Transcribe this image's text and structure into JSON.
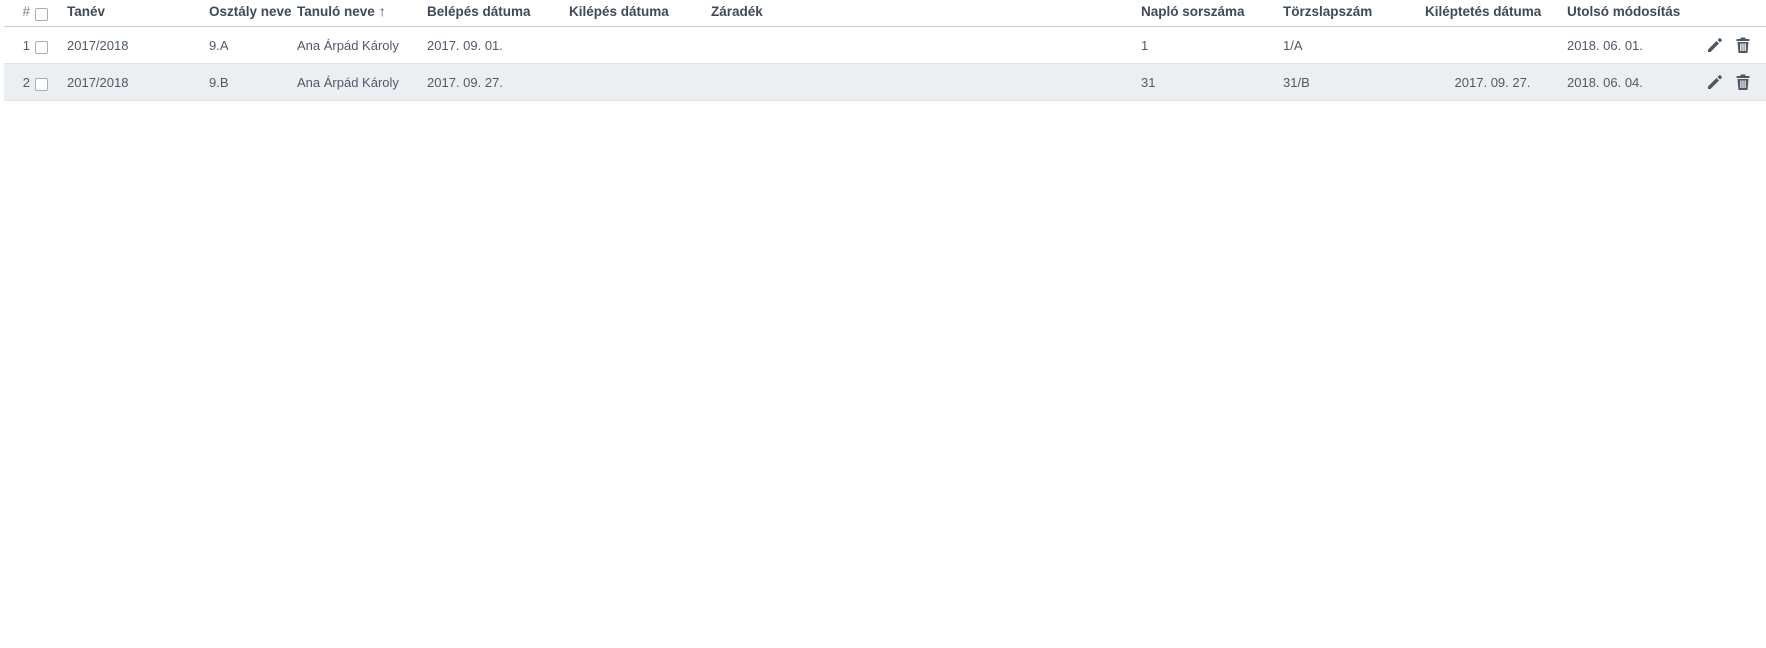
{
  "table": {
    "columns": {
      "index": "#",
      "tanev": "Tanév",
      "osztaly": "Osztály neve",
      "tanulo": "Tanuló neve",
      "tanulo_sort": "↑",
      "belepes": "Belépés dátuma",
      "kilepes": "Kilépés dátuma",
      "zaradek": "Záradék",
      "naplo": "Napló sorszáma",
      "torzs": "Törzslapszám",
      "kileptetes": "Kiléptetés dátuma",
      "utolso": "Utolsó módosítás"
    },
    "rows": [
      {
        "index": "1",
        "tanev": "2017/2018",
        "osztaly": "9.A",
        "tanulo": "Ana Árpád Károly",
        "belepes": "2017. 09. 01.",
        "kilepes": "",
        "zaradek": "",
        "naplo": "1",
        "torzs": "1/A",
        "kileptetes": "",
        "utolso": "2018. 06. 01."
      },
      {
        "index": "2",
        "tanev": "2017/2018",
        "osztaly": "9.B",
        "tanulo": "Ana Árpád Károly",
        "belepes": "2017. 09. 27.",
        "kilepes": "",
        "zaradek": "",
        "naplo": "31",
        "torzs": "31/B",
        "kileptetes": "2017. 09. 27.",
        "utolso": "2018. 06. 04."
      }
    ]
  },
  "icons": {
    "edit": "pencil-icon",
    "delete": "trash-icon"
  },
  "colors": {
    "text": "#4e5a68",
    "header_text": "#3f4a57",
    "alt_row": "#eceff2",
    "icon": "#4d5866"
  }
}
